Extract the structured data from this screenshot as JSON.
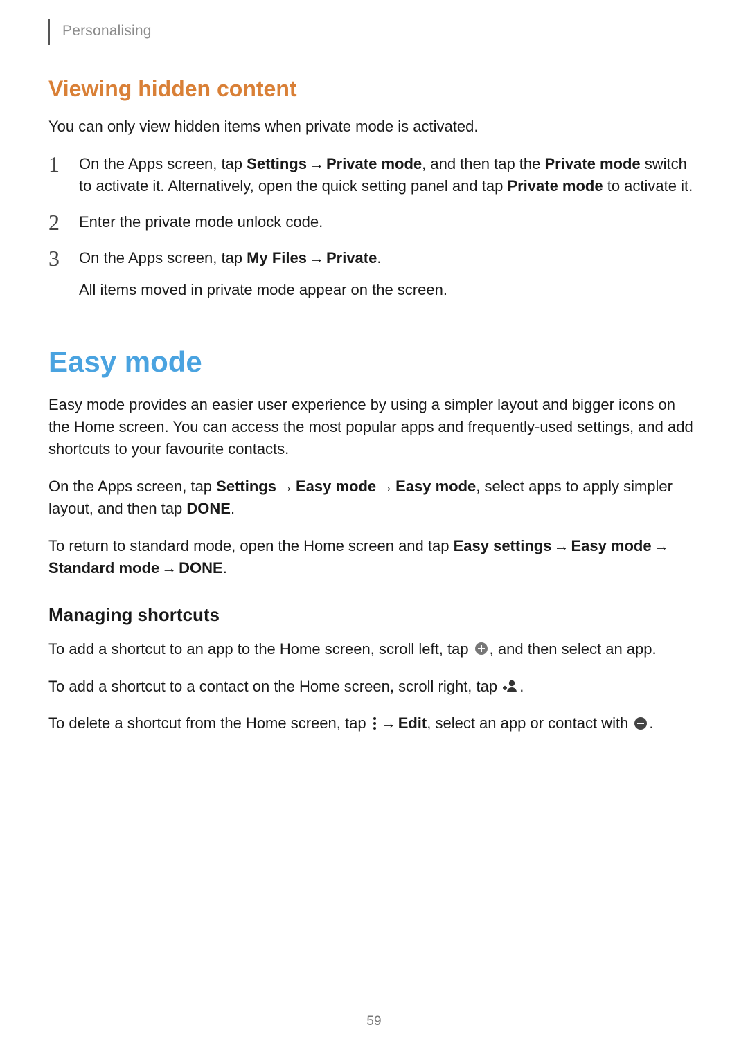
{
  "header": {
    "section_label": "Personalising"
  },
  "section1": {
    "title": "Viewing hidden content",
    "intro": "You can only view hidden items when private mode is activated.",
    "steps": [
      {
        "num": "1",
        "line1_pre": "On the Apps screen, tap ",
        "line1_b1": "Settings",
        "line1_arrow1": " → ",
        "line1_b2": "Private mode",
        "line1_mid": ", and then tap the ",
        "line1_b3": "Private mode",
        "line1_post": " switch to activate it. Alternatively, open the quick setting panel and tap ",
        "line1_b4": "Private mode",
        "line1_end": " to activate it."
      },
      {
        "num": "2",
        "text": "Enter the private mode unlock code."
      },
      {
        "num": "3",
        "line1_pre": "On the Apps screen, tap ",
        "line1_b1": "My Files",
        "line1_arrow1": " → ",
        "line1_b2": "Private",
        "line1_post": ".",
        "line2": "All items moved in private mode appear on the screen."
      }
    ]
  },
  "section2": {
    "title": "Easy mode",
    "p1": "Easy mode provides an easier user experience by using a simpler layout and bigger icons on the Home screen. You can access the most popular apps and frequently-used settings, and add shortcuts to your favourite contacts.",
    "p2": {
      "pre": "On the Apps screen, tap ",
      "b1": "Settings",
      "a1": " → ",
      "b2": "Easy mode",
      "a2": " → ",
      "b3": "Easy mode",
      "mid": ", select apps to apply simpler layout, and then tap ",
      "b4": "DONE",
      "post": "."
    },
    "p3": {
      "pre": "To return to standard mode, open the Home screen and tap ",
      "b1": "Easy settings",
      "a1": " → ",
      "b2": "Easy mode",
      "a2": " → ",
      "b3": "Standard mode",
      "a3": " → ",
      "b4": "DONE",
      "post": "."
    },
    "subhead": "Managing shortcuts",
    "p4": {
      "pre": "To add a shortcut to an app to the Home screen, scroll left, tap ",
      "post": ", and then select an app."
    },
    "p5": {
      "pre": "To add a shortcut to a contact on the Home screen, scroll right, tap ",
      "post": "."
    },
    "p6": {
      "pre": "To delete a shortcut from the Home screen, tap ",
      "a1": " → ",
      "b1": "Edit",
      "mid": ", select an app or contact with ",
      "post": "."
    }
  },
  "page_number": "59"
}
